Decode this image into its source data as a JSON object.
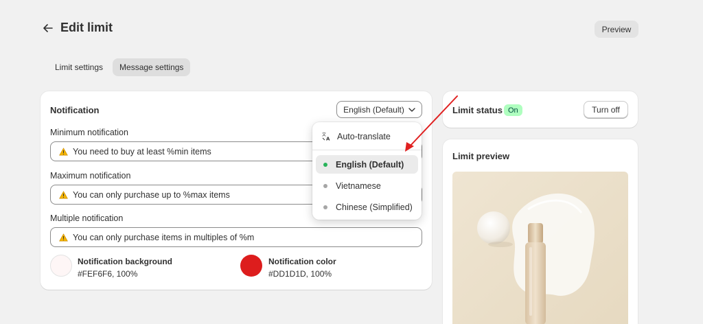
{
  "header": {
    "title": "Edit limit",
    "preview_label": "Preview"
  },
  "tabs": [
    {
      "label": "Limit settings",
      "active": false
    },
    {
      "label": "Message settings",
      "active": true
    }
  ],
  "notification": {
    "title": "Notification",
    "language_selected": "English (Default)",
    "fields": [
      {
        "label": "Minimum notification",
        "value": "You need to buy at least %min items"
      },
      {
        "label": "Maximum notification",
        "value": "You can only purchase up to %max items"
      },
      {
        "label": "Multiple notification",
        "value": "You can only purchase items in multiples of %m"
      }
    ],
    "background": {
      "label": "Notification background",
      "value": "#FEF6F6, 100%",
      "color": "#FEF6F6"
    },
    "color": {
      "label": "Notification color",
      "value": "#DD1D1D, 100%",
      "color": "#DD1D1D"
    }
  },
  "language_dropdown": {
    "auto_translate": "Auto-translate",
    "options": [
      {
        "label": "English (Default)",
        "selected": true,
        "dot_color": "#29b35a"
      },
      {
        "label": "Vietnamese",
        "selected": false,
        "dot_color": "#a6a6a6"
      },
      {
        "label": "Chinese (Simplified)",
        "selected": false,
        "dot_color": "#a6a6a6"
      }
    ]
  },
  "limit_status": {
    "title": "Limit status",
    "badge": "On",
    "button": "Turn off"
  },
  "limit_preview": {
    "title": "Limit preview"
  },
  "colors": {
    "annotation_arrow": "#e02020",
    "page_bg": "#f1f1f1"
  }
}
